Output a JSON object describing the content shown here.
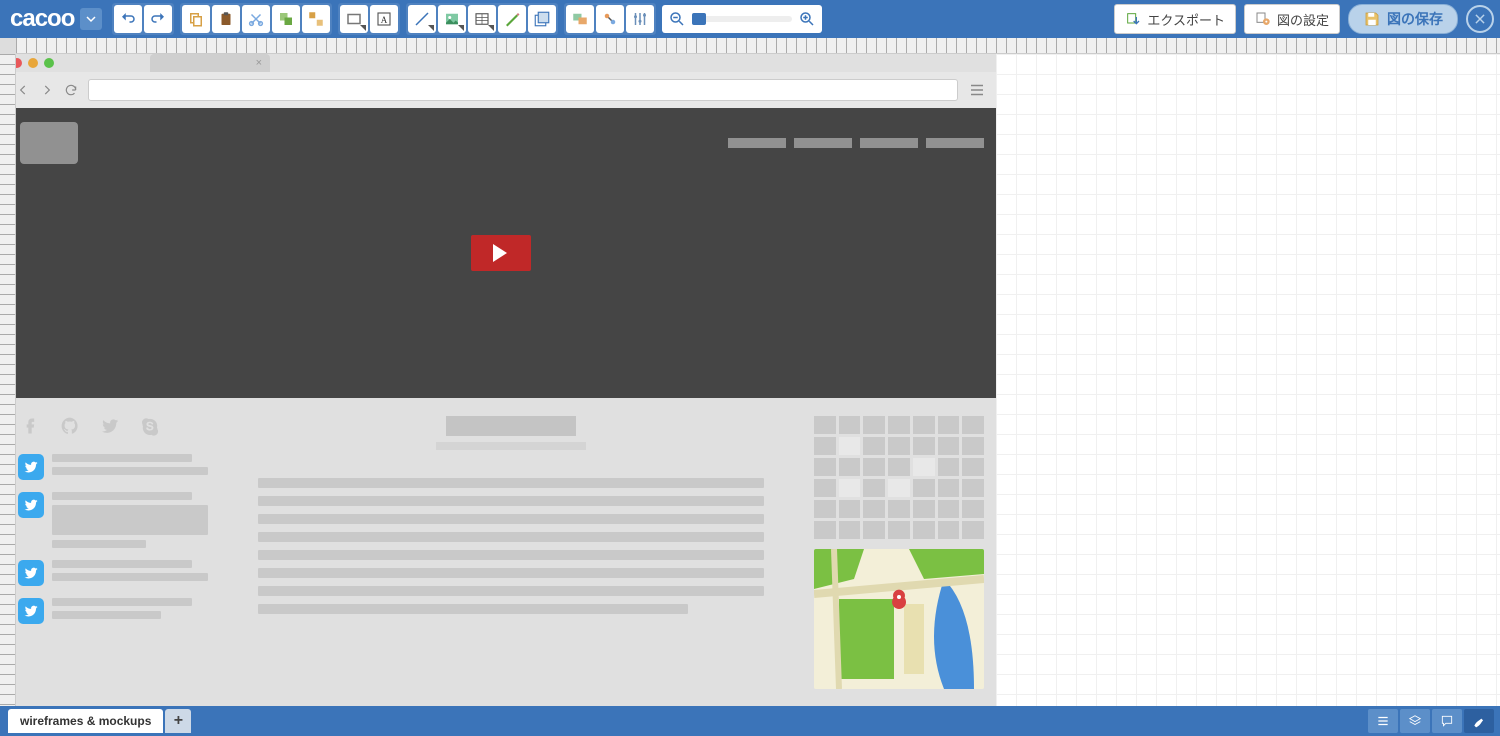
{
  "app": {
    "logo_text": "cacoo"
  },
  "top_actions": {
    "export": "エクスポート",
    "settings": "図の設定",
    "save": "図の保存"
  },
  "sheets": {
    "active": "wireframes & mockups"
  },
  "wireframe": {
    "browser_close_glyph": "×",
    "nav_items_count": 4,
    "social_icons": [
      "facebook",
      "github",
      "twitter",
      "skype"
    ],
    "tweets_count": 4,
    "calendar_rows": 6,
    "calendar_cols": 7
  }
}
